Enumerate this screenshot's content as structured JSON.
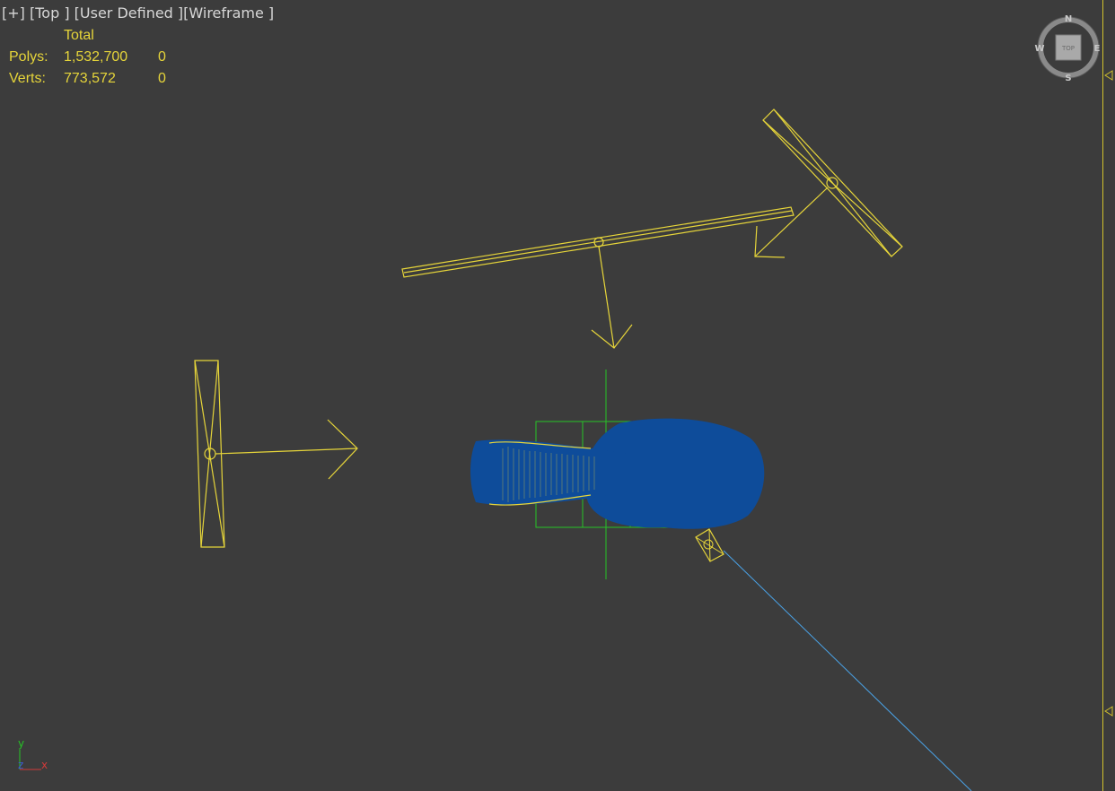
{
  "viewport": {
    "label_plus": "[+]",
    "label_view": "[Top ]",
    "label_shading_mode": "[User Defined ]",
    "label_display": "[Wireframe ]"
  },
  "stats": {
    "header": "Total",
    "polys_label": "Polys:",
    "polys_total": "1,532,700",
    "polys_selected": "0",
    "verts_label": "Verts:",
    "verts_total": "773,572",
    "verts_selected": "0"
  },
  "viewcube": {
    "face": "TOP",
    "north": "N",
    "south": "S",
    "east": "E",
    "west": "W"
  },
  "axis_gizmo": {
    "x": "x",
    "y": "y",
    "z": "z"
  },
  "colors": {
    "background": "#3c3c3c",
    "light_wire": "#e6d53a",
    "mesh_fill": "#0e4c9a",
    "grid_axis": "#26c326",
    "camera_line": "#4aa3e8"
  }
}
